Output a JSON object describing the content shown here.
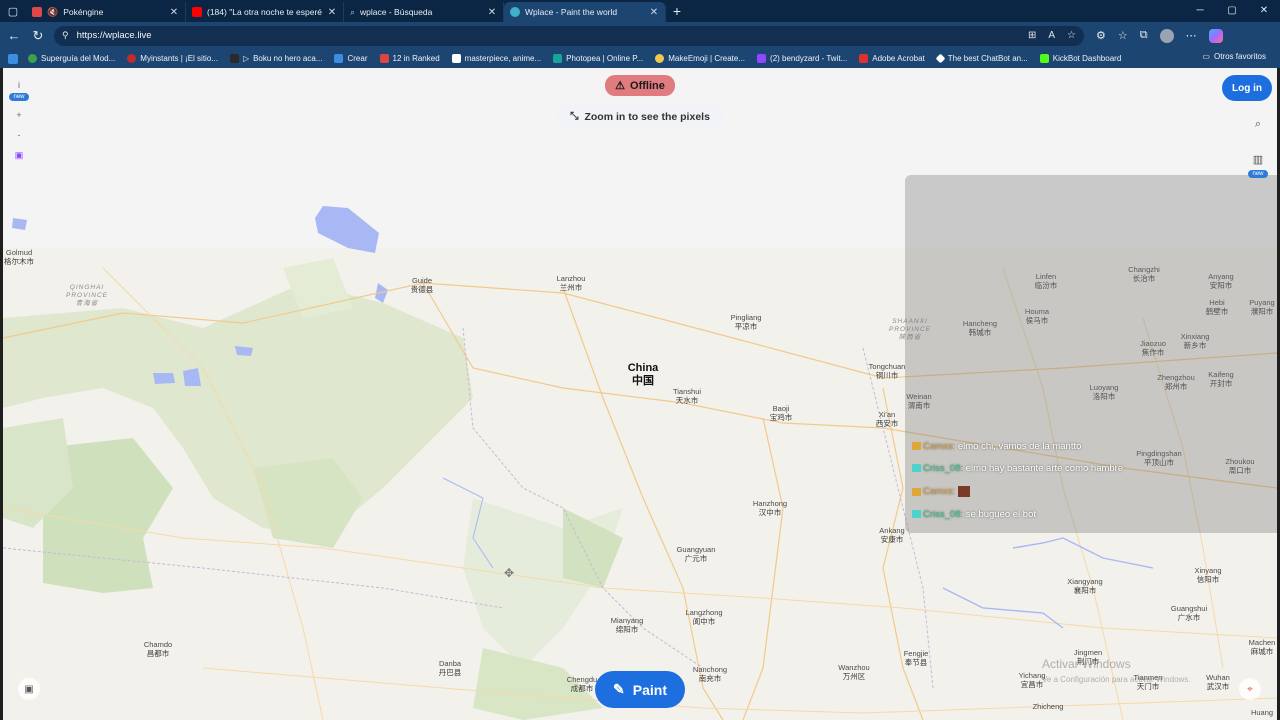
{
  "browser": {
    "tabs": [
      {
        "title": "Pokéngine",
        "favicon_color": "#e04848",
        "active": false,
        "muted": true
      },
      {
        "title": "(184) \"La otra noche te esperé ba...",
        "favicon_color": "#ff0000",
        "active": false
      },
      {
        "title": "wplace - Búsqueda",
        "favicon_color": "#4aa3ff",
        "active": false
      },
      {
        "title": "Wplace - Paint the world",
        "favicon_color": "#3fb0c9",
        "active": true
      }
    ],
    "url": "https://wplace.live",
    "bookmarks": [
      {
        "label": "Superguía del Mod...",
        "color": "#3aa24a"
      },
      {
        "label": "Myinstants | ¡El sitio...",
        "color": "#c22b2b"
      },
      {
        "label": "Boku no hero aca...",
        "color": "#2a2a2a"
      },
      {
        "label": "Crear",
        "color": "#3b8ee0"
      },
      {
        "label": "12 in Ranked",
        "color": "#d44"
      },
      {
        "label": "masterpiece, anime...",
        "color": "#ffffff"
      },
      {
        "label": "Photopea | Online P...",
        "color": "#18a497"
      },
      {
        "label": "MakeEmoji | Create...",
        "color": "#f2c94c"
      },
      {
        "label": "(2) bendyzard - Twit...",
        "color": "#9146ff"
      },
      {
        "label": "Adobe Acrobat",
        "color": "#e03131"
      },
      {
        "label": "The best ChatBot an...",
        "color": "#ffffff"
      },
      {
        "label": "KickBot Dashboard",
        "color": "#53fc18"
      }
    ],
    "other_bookmarks": "Otros favoritos"
  },
  "app": {
    "offline_label": "Offline",
    "zoom_hint": "Zoom in to see the pixels",
    "login_label": "Log in",
    "paint_label": "Paint",
    "new_badge": "new",
    "info_label": "i"
  },
  "map": {
    "country": {
      "en": "China",
      "cn": "中国"
    },
    "provinces": [
      {
        "name": "QINGHAI\nPROVINCE",
        "cn": "青海省"
      },
      {
        "name": "SHAANXI\nPROVINCE",
        "cn": "陕西省"
      }
    ],
    "cities": [
      {
        "en": "Golmud",
        "cn": "格尔木市"
      },
      {
        "en": "Guide",
        "cn": "贵德县"
      },
      {
        "en": "Lanzhou",
        "cn": "兰州市"
      },
      {
        "en": "Pingliang",
        "cn": "平凉市"
      },
      {
        "en": "Tianshui",
        "cn": "天水市"
      },
      {
        "en": "Baoji",
        "cn": "宝鸡市"
      },
      {
        "en": "Tongchuan",
        "cn": "铜川市"
      },
      {
        "en": "Weinan",
        "cn": "渭南市"
      },
      {
        "en": "Xi'an",
        "cn": "西安市"
      },
      {
        "en": "Linfen",
        "cn": "临汾市"
      },
      {
        "en": "Changzhi",
        "cn": "长治市"
      },
      {
        "en": "Anyang",
        "cn": "安阳市"
      },
      {
        "en": "Hebi",
        "cn": "鹤壁市"
      },
      {
        "en": "Puyang",
        "cn": "濮阳市"
      },
      {
        "en": "Hancheng",
        "cn": "韩城市"
      },
      {
        "en": "Houma",
        "cn": "侯马市"
      },
      {
        "en": "Jiaozuo",
        "cn": "焦作市"
      },
      {
        "en": "Xinxiang",
        "cn": "新乡市"
      },
      {
        "en": "Luoyang",
        "cn": "洛阳市"
      },
      {
        "en": "Zhengzhou",
        "cn": "郑州市"
      },
      {
        "en": "Kaifeng",
        "cn": "开封市"
      },
      {
        "en": "Pingdingshan",
        "cn": "平顶山市"
      },
      {
        "en": "Zhoukou",
        "cn": "周口市"
      },
      {
        "en": "Hanzhong",
        "cn": "汉中市"
      },
      {
        "en": "Ankang",
        "cn": "安康市"
      },
      {
        "en": "Guangyuan",
        "cn": "广元市"
      },
      {
        "en": "Xiangyang",
        "cn": "襄阳市"
      },
      {
        "en": "Xinyang",
        "cn": "信阳市"
      },
      {
        "en": "Langzhong",
        "cn": "阆中市"
      },
      {
        "en": "Mianyang",
        "cn": "绵阳市"
      },
      {
        "en": "Guangshui",
        "cn": "广水市"
      },
      {
        "en": "Chamdo",
        "cn": "昌都市"
      },
      {
        "en": "Danba",
        "cn": "丹巴县"
      },
      {
        "en": "Nanchong",
        "cn": "南充市"
      },
      {
        "en": "Wanzhou",
        "cn": "万州区"
      },
      {
        "en": "Fengjie",
        "cn": "奉节县"
      },
      {
        "en": "Jingmen",
        "cn": "荆门市"
      },
      {
        "en": "Yichang",
        "cn": "宜昌市"
      },
      {
        "en": "Machen",
        "cn": "麻城市"
      },
      {
        "en": "Chengdu",
        "cn": "成都市"
      },
      {
        "en": "Tianmen",
        "cn": "天门市"
      },
      {
        "en": "Wuhan",
        "cn": "武汉市"
      },
      {
        "en": "Zhicheng",
        "cn": ""
      },
      {
        "en": "Huang",
        "cn": ""
      }
    ]
  },
  "chat": [
    {
      "user": "Camxs:",
      "text": "elmo chi, vamos de la mantto",
      "badge": "orange"
    },
    {
      "user": "Criss_08:",
      "text": "elmo hay bastante arte como hambre",
      "badge": "teal"
    },
    {
      "user": "Camxs:",
      "text": "",
      "badge": "orange"
    },
    {
      "user": "Criss_08:",
      "text": "se bugueo el bot",
      "badge": "teal"
    }
  ],
  "watermark": {
    "line1": "Activar Windows",
    "line2": "Ve a Configuración para activar Windows."
  }
}
